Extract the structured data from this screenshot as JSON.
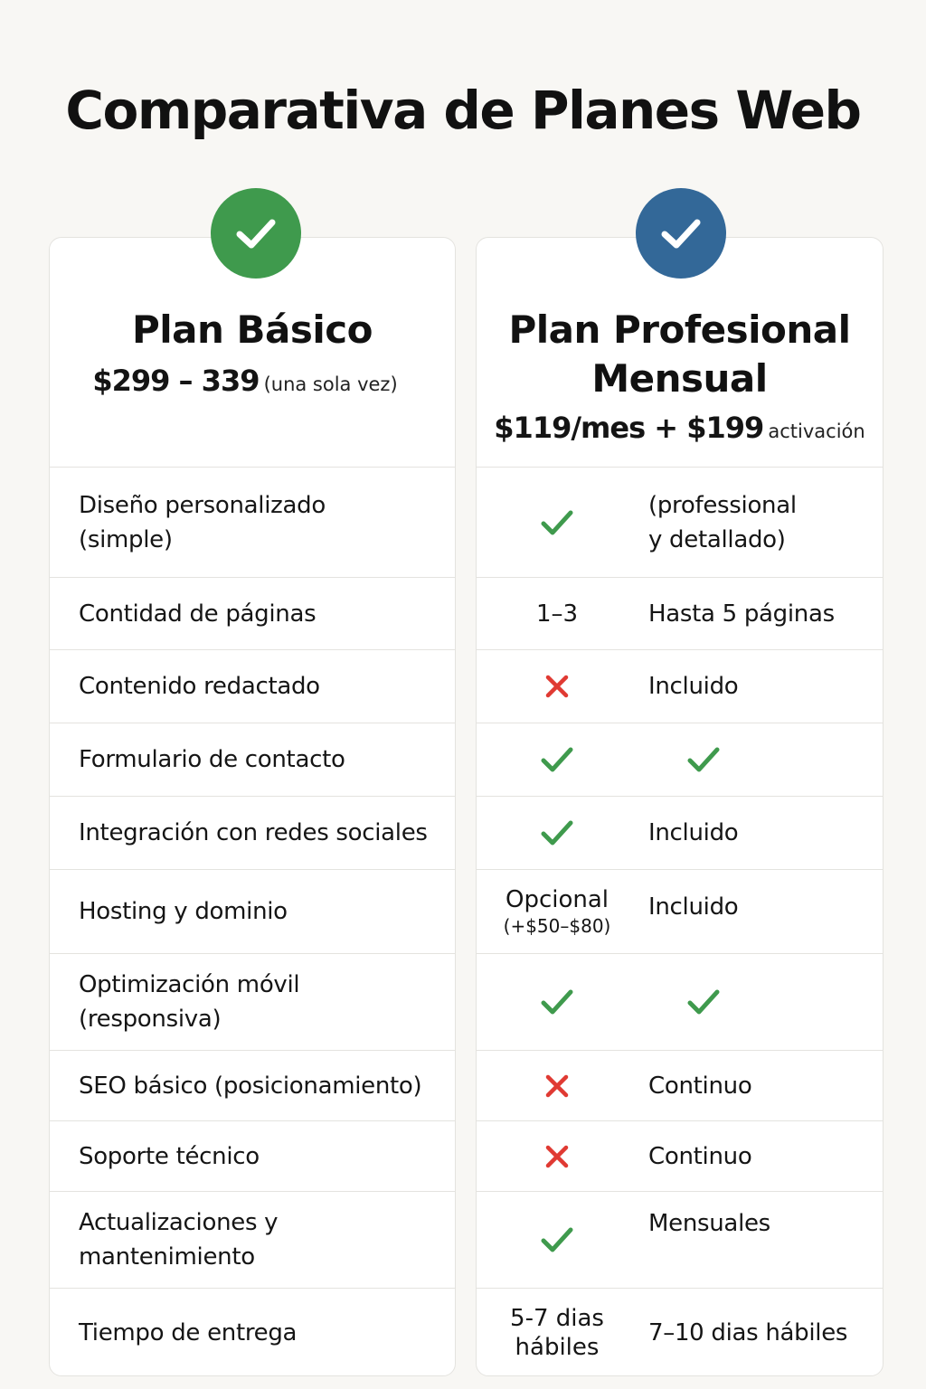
{
  "title": "Comparativa de Planes Web",
  "colors": {
    "check_green": "#3f9a4d",
    "plan_blue": "#336898",
    "cross_red": "#e03a33"
  },
  "plans": {
    "basic": {
      "name": "Plan Básico",
      "price": "$299 – 339",
      "price_note": "(una sola vez)",
      "badge_icon": "check-icon"
    },
    "pro": {
      "name_line1": "Plan Profesional",
      "name_line2": "Mensual",
      "price": "$119/mes + $199",
      "price_note": "activación",
      "badge_icon": "check-icon"
    }
  },
  "features": [
    {
      "label_lines": [
        "Diseño personalizado",
        "(simple)"
      ],
      "basic": {
        "icon": "check"
      },
      "pro": {
        "text_lines": [
          "(professional",
          "y detallado)"
        ]
      }
    },
    {
      "label_lines": [
        "Contidad de páginas"
      ],
      "basic": {
        "text": "1–3"
      },
      "pro": {
        "text": "Hasta 5 páginas"
      }
    },
    {
      "label_lines": [
        "Contenido redactado"
      ],
      "basic": {
        "icon": "cross"
      },
      "pro": {
        "text": "Incluido"
      }
    },
    {
      "label_lines": [
        "Formulario de contacto"
      ],
      "basic": {
        "icon": "check"
      },
      "pro": {
        "icon": "check"
      }
    },
    {
      "label_lines": [
        "Integración con redes sociales"
      ],
      "basic": {
        "icon": "check"
      },
      "pro": {
        "text": "Incluido"
      }
    },
    {
      "label_lines": [
        "Hosting y dominio"
      ],
      "basic": {
        "text": "Opcional",
        "note": "(+$50–$80)"
      },
      "pro": {
        "text": "Incluido"
      }
    },
    {
      "label_lines": [
        "Optimización móvil",
        "(responsiva)"
      ],
      "basic": {
        "icon": "check"
      },
      "pro": {
        "icon": "check"
      }
    },
    {
      "label_lines": [
        "SEO básico (posicionamiento)"
      ],
      "basic": {
        "icon": "cross"
      },
      "pro": {
        "text": "Continuo"
      }
    },
    {
      "label_lines": [
        "Soporte técnico"
      ],
      "basic": {
        "icon": "cross"
      },
      "pro": {
        "text": "Continuo"
      }
    },
    {
      "label_lines": [
        "Actualizaciones y",
        "mantenimiento"
      ],
      "basic": {
        "icon": "check"
      },
      "pro": {
        "text": "Mensuales"
      }
    },
    {
      "label_lines": [
        "Tiempo de entrega"
      ],
      "basic": {
        "text": "5-7 dias",
        "note": "hábiles"
      },
      "pro": {
        "text": "7–10 dias hábiles"
      }
    }
  ]
}
